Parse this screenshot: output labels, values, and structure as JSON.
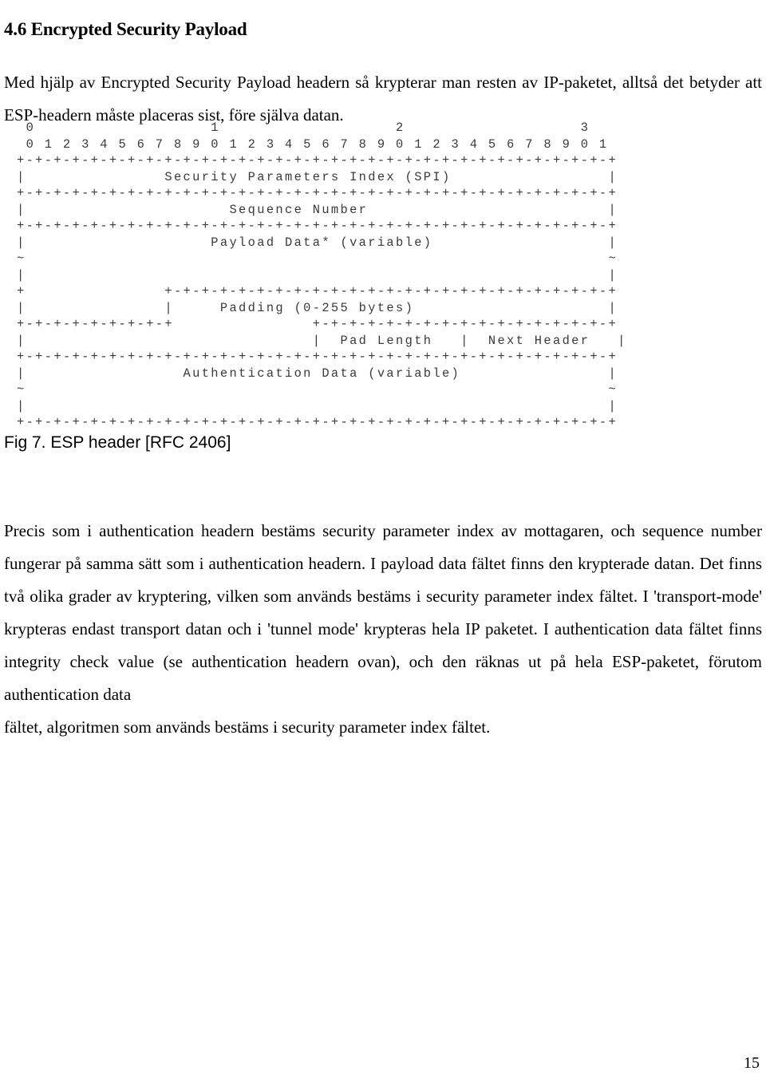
{
  "document": {
    "heading": "4.6 Encrypted Security Payload",
    "intro_paragraph": "Med hjälp av Encrypted Security Payload headern så krypterar man resten av IP-paketet, alltså det betyder att ESP-headern måste placeras sist, före själva datan.",
    "figure": {
      "caption": "Fig 7. ESP header [RFC 2406]",
      "ascii_diagram": " 0                   1                   2                   3\n 0 1 2 3 4 5 6 7 8 9 0 1 2 3 4 5 6 7 8 9 0 1 2 3 4 5 6 7 8 9 0 1\n+-+-+-+-+-+-+-+-+-+-+-+-+-+-+-+-+-+-+-+-+-+-+-+-+-+-+-+-+-+-+-+-+\n|               Security Parameters Index (SPI)                 |\n+-+-+-+-+-+-+-+-+-+-+-+-+-+-+-+-+-+-+-+-+-+-+-+-+-+-+-+-+-+-+-+-+\n|                      Sequence Number                          |\n+-+-+-+-+-+-+-+-+-+-+-+-+-+-+-+-+-+-+-+-+-+-+-+-+-+-+-+-+-+-+-+-+\n|                    Payload Data* (variable)                   |\n~                                                               ~\n|                                                               |\n+               +-+-+-+-+-+-+-+-+-+-+-+-+-+-+-+-+-+-+-+-+-+-+-+-+\n|               |     Padding (0-255 bytes)                     |\n+-+-+-+-+-+-+-+-+               +-+-+-+-+-+-+-+-+-+-+-+-+-+-+-+-+\n|                               |  Pad Length   |  Next Header   |\n+-+-+-+-+-+-+-+-+-+-+-+-+-+-+-+-+-+-+-+-+-+-+-+-+-+-+-+-+-+-+-+-+\n|                 Authentication Data (variable)                |\n~                                                               ~\n|                                                               |\n+-+-+-+-+-+-+-+-+-+-+-+-+-+-+-+-+-+-+-+-+-+-+-+-+-+-+-+-+-+-+-+-+",
      "fields": [
        "Security Parameters Index (SPI)",
        "Sequence Number",
        "Payload Data* (variable)",
        "Padding (0-255 bytes)",
        "Pad Length",
        "Next Header",
        "Authentication Data (variable)"
      ],
      "bit_ruler_decades": [
        "0",
        "1",
        "2",
        "3"
      ],
      "bit_ruler_units": "0 1 2 3 4 5 6 7 8 9 0 1 2 3 4 5 6 7 8 9 0 1 2 3 4 5 6 7 8 9 0 1"
    },
    "body_paragraph_main": "Precis som i authentication headern bestäms security parameter index av mottagaren, och sequence number fungerar på samma sätt som i authentication headern. I payload data fältet finns den krypterade datan. Det finns två olika grader av kryptering, vilken som används bestäms i security parameter index fältet. I 'transport-mode' krypteras endast transport datan och i 'tunnel mode' krypteras hela IP paketet.  I authentication data fältet finns integrity check value (se authentication headern ovan), och den räknas ut på hela ESP-paketet, förutom authentication data",
    "body_paragraph_last_line": "fältet, algoritmen som används bestäms i security parameter index  fältet.",
    "page_number": "15"
  }
}
